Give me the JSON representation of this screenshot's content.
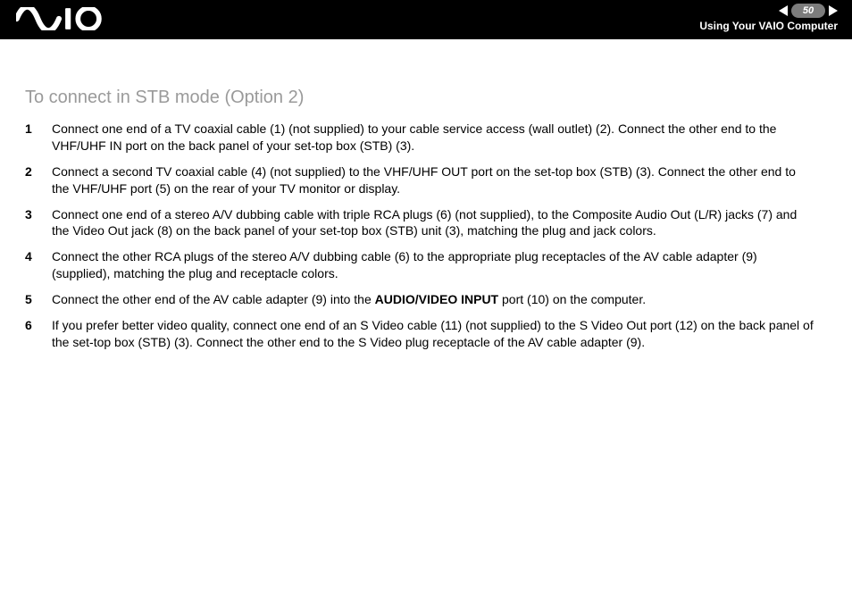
{
  "header": {
    "page_number": "50",
    "section": "Using Your VAIO Computer",
    "logo_alt": "VAIO"
  },
  "content": {
    "heading": "To connect in STB mode (Option 2)",
    "steps": [
      {
        "text": "Connect one end of a TV coaxial cable (1) (not supplied) to your cable service access (wall outlet) (2). Connect the other end to the VHF/UHF IN port on the back panel of your set-top box (STB) (3)."
      },
      {
        "text": "Connect a second TV coaxial cable (4) (not supplied) to the VHF/UHF OUT port on the set-top box (STB) (3). Connect the other end to the VHF/UHF port (5) on the rear of your TV monitor or display."
      },
      {
        "text": "Connect one end of a stereo A/V dubbing cable with triple RCA plugs (6) (not supplied), to the Composite Audio Out (L/R) jacks (7) and the Video Out jack (8) on the back panel of your set-top box (STB) unit (3), matching the plug and jack colors."
      },
      {
        "text": "Connect the other RCA plugs of the stereo A/V dubbing cable (6) to the appropriate plug receptacles of the AV cable adapter (9) (supplied), matching the plug and receptacle colors."
      },
      {
        "text_pre": "Connect the other end of the AV cable adapter (9) into the ",
        "bold": "AUDIO/VIDEO INPUT",
        "text_post": " port (10) on the computer."
      },
      {
        "text": "If you prefer better video quality, connect one end of an S Video cable (11) (not supplied) to the S Video Out port (12) on the back panel of the set-top box (STB) (3). Connect the other end to the S Video plug receptacle of the AV cable adapter (9)."
      }
    ]
  }
}
